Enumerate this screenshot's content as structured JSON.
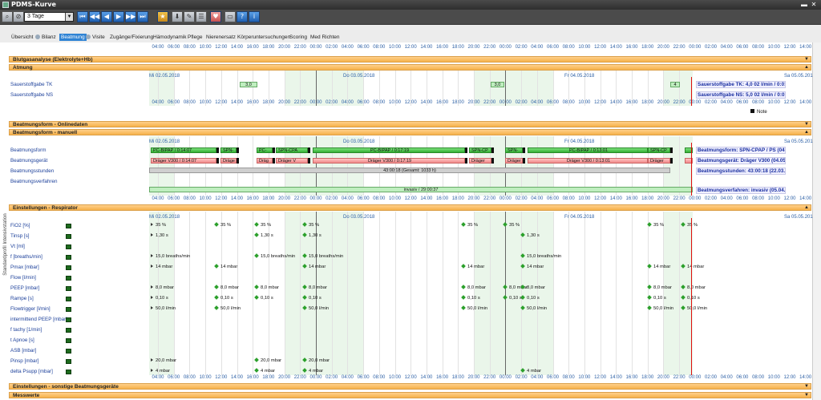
{
  "window": {
    "title": "PDMS-Kurve"
  },
  "toolbar": {
    "range_value": "3 Tage"
  },
  "tabs": [
    {
      "label": "Übersicht"
    },
    {
      "label": "Bilanz"
    },
    {
      "label": "Beatmung"
    },
    {
      "label": "Visite"
    },
    {
      "label": "Zugänge/Fixierung"
    },
    {
      "label": "Hämodynamik"
    },
    {
      "label": "Pflege"
    },
    {
      "label": "Nierenersatz"
    },
    {
      "label": "Körperuntersuchungen"
    },
    {
      "label": "Scoring"
    },
    {
      "label": "Med Richten"
    }
  ],
  "time_ticks": [
    "04:00",
    "06:00",
    "08:00",
    "10:00",
    "12:00",
    "14:00",
    "16:00",
    "18:00",
    "20:00",
    "22:00",
    "00:00",
    "02:00",
    "04:00",
    "06:00",
    "08:00",
    "10:00",
    "12:00",
    "14:00",
    "16:00",
    "18:00",
    "20:00",
    "22:00",
    "00:00",
    "02:00",
    "04:00",
    "06:00",
    "08:00",
    "10:00",
    "12:00",
    "14:00",
    "16:00",
    "18:00",
    "20:00",
    "22:00",
    "00:00",
    "02:00",
    "04:00",
    "06:00",
    "08:00",
    "10:00",
    "12:00",
    "14:00"
  ],
  "dates": [
    "Mi 02.05.2018",
    "Do 03.05.2018",
    "Fr 04.05.2018",
    "Sa 05.05.201"
  ],
  "sections": {
    "blutgas": "Blutgasanalyse (Elektrolyte+Hb)",
    "atmung": "Atmung",
    "online": "Beatmungsform - Onlinedaten",
    "manuell": "Beatmungsform - manuell",
    "respirator": "Einstellungen - Respirator",
    "sonstige": "Einstellungen - sonstige Beatmungsgeräte",
    "messwerte": "Messwerte"
  },
  "atmung": {
    "rows": [
      "Sauerstoffgabe TK",
      "Sauerstoffgabe NS"
    ],
    "bars": [
      "3,0",
      "3,0",
      "4"
    ],
    "info": [
      "Sauerstoffgabe TK: 4,0 02 l/min / 0:01:22",
      "Sauerstoffgabe NS: 5,0 02 l/min / 0:01:45"
    ],
    "note": "Note"
  },
  "manuell": {
    "rows": [
      "Beatmungsform",
      "Beatmungsgerät",
      "Beatmungsstunden",
      "Beatmungsverfahren"
    ],
    "form_bars": [
      "PC-BIPAP / 0:14:07",
      "SPN-",
      "PC-",
      "SPN-CPA",
      "PC-BIPAP / 0:17:19",
      "SPN-CP",
      "SPN-",
      "PC-BIPAP / 0:13:01",
      "SPN-CP"
    ],
    "geraet_bars": [
      "Dräger V300 / 0:14:07",
      "Dräge",
      "Dräg",
      "Dräger V",
      "Dräger V300 / 0:17:19",
      "Dräger",
      "Dräger",
      "Dräger V300 / 0:13:01",
      "Dräger"
    ],
    "stunden_bar": "43:00:18 (Gesamt: 1033 h)",
    "verfahren_bar": "invasiv / 29:00:37",
    "info": [
      "Beatmungsform: SPN-CPAP / PS (04.05.)",
      "Beatmungsgerät: Dräger V300 (04.05.)",
      "Beatmungsstunden: 43:00:18 (22.03.)",
      "Beatmungsverfahren: invasiv (05.04.)"
    ]
  },
  "respirator": {
    "rows": [
      "FiO2 [%]",
      "Tinsp [s]",
      "Vt [ml]",
      "f [breaths/min]",
      "Pmax [mbar]",
      "Flow [l/min]",
      "PEEP [mbar]",
      "Rampe [s]",
      "Flowtrigger [l/min]",
      "intermittend PEEP [mbar]",
      "f tachy [1/min]",
      "t Apnoe [s]",
      "ASB [mbar]",
      "Pinsp [mbar]",
      "delta Psupp [mbar]"
    ],
    "values": {
      "fio2": "35 %",
      "tinsp": "1,30 s",
      "f": "15,0 breaths/min",
      "pmax": "14 mbar",
      "peep": "8,0 mbar",
      "rampe": "0,10 s",
      "flowtrigger": "50,0 l/min",
      "pinsp": "20,0 mbar",
      "dpsupp": "4 mbar"
    }
  },
  "sidebar": {
    "vertical_label": "Standardprofil Intensivstation"
  }
}
